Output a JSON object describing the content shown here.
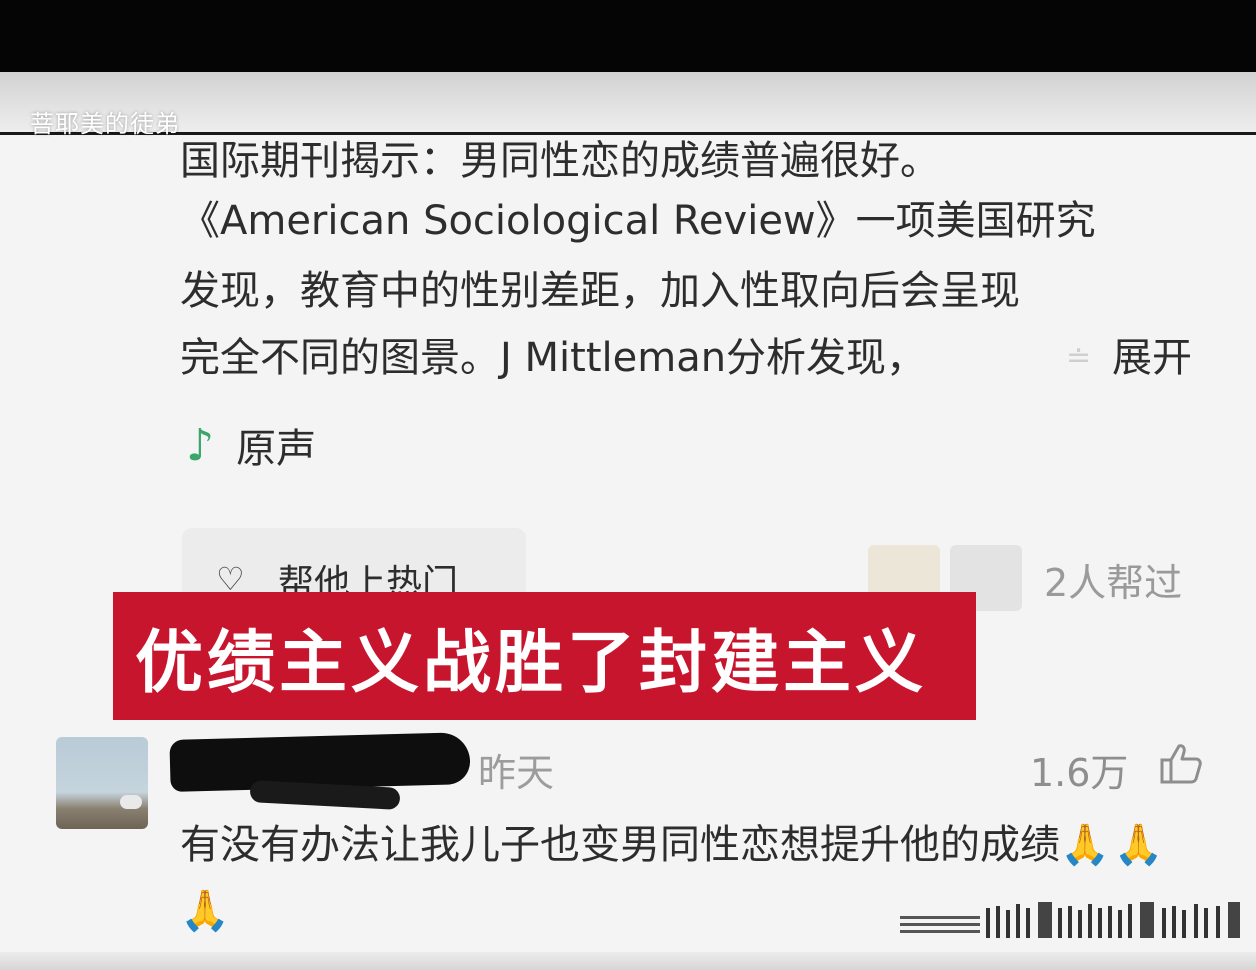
{
  "watermark": "菩耶美的徒弟",
  "post": {
    "lines": [
      "国际期刊揭示：男同性恋的成绩普遍很好。",
      "《American Sociological Review》一项美国研究",
      "发现，教育中的性别差距，加入性取向后会呈现",
      "完全不同的图景。J Mittleman分析发现，"
    ],
    "ellipsis_mark": "≐",
    "expand_label": "展开",
    "sound_icon": "music-note-icon",
    "sound_label": "原声"
  },
  "boost": {
    "icon": "heart-boost-icon",
    "label": "帮他上热门",
    "helpers_count": "2人帮过"
  },
  "caption": "优绩主义战胜了封建主义",
  "comment": {
    "time": "昨天",
    "likes": "1.6万",
    "text": "有没有办法让我儿子也变男同性恋想提升他的成绩",
    "emojis": "🙏🙏🙏"
  },
  "colors": {
    "caption_bg": "#c8152e",
    "accent_green": "#3aa66a",
    "top_bar": "#050505"
  }
}
